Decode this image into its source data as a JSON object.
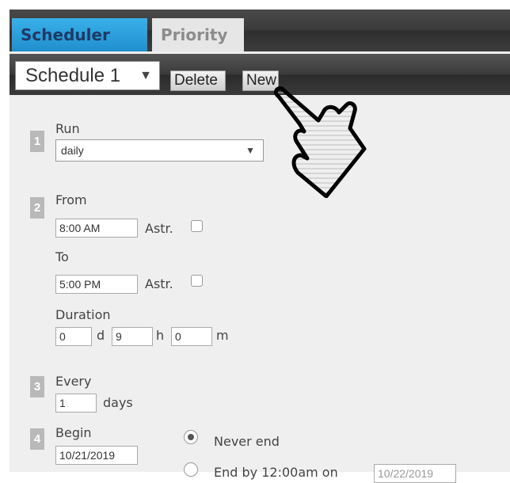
{
  "tabs": {
    "scheduler": "Scheduler",
    "priority": "Priority"
  },
  "toolbar": {
    "schedule_select": "Schedule 1",
    "delete": "Delete",
    "new": "New"
  },
  "steps": {
    "run": "1",
    "from": "2",
    "every": "3",
    "begin": "4"
  },
  "run": {
    "label": "Run",
    "value": "daily"
  },
  "from": {
    "label": "From",
    "value": "8:00 AM",
    "astr": "Astr."
  },
  "to": {
    "label": "To",
    "value": "5:00 PM",
    "astr": "Astr."
  },
  "duration": {
    "label": "Duration",
    "days": "0",
    "d": "d",
    "hours": "9",
    "h": "h",
    "minutes": "0",
    "m": "m"
  },
  "every": {
    "label": "Every",
    "value": "1",
    "unit": "days"
  },
  "begin": {
    "label": "Begin",
    "value": "10/21/2019"
  },
  "end": {
    "never": "Never end",
    "end_by": "End by 12:00am on",
    "end_by_date": "10/22/2019"
  },
  "icons": {
    "dropdown": "chevron-down-icon",
    "cursor": "hand-pointer-icon"
  }
}
